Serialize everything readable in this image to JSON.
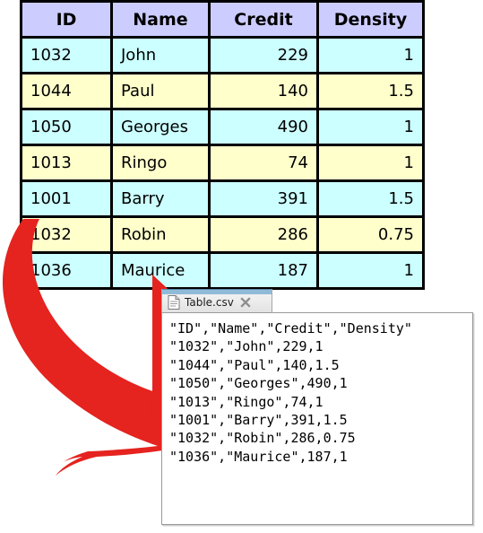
{
  "table": {
    "name": "spreadsheet-table",
    "columns": [
      "ID",
      "Name",
      "Credit",
      "Density"
    ],
    "rows": [
      {
        "id": "1032",
        "name": "John",
        "credit": "229",
        "density": "1"
      },
      {
        "id": "1044",
        "name": "Paul",
        "credit": "140",
        "density": "1.5"
      },
      {
        "id": "1050",
        "name": "Georges",
        "credit": "490",
        "density": "1"
      },
      {
        "id": "1013",
        "name": "Ringo",
        "credit": "74",
        "density": "1"
      },
      {
        "id": "1001",
        "name": "Barry",
        "credit": "391",
        "density": "1.5"
      },
      {
        "id": "1032",
        "name": "Robin",
        "credit": "286",
        "density": "0.75"
      },
      {
        "id": "1036",
        "name": "Maurice",
        "credit": "187",
        "density": "1"
      }
    ],
    "colors": {
      "header_background": "#ccccff",
      "row_odd_background": "#ccffff",
      "row_even_background": "#ffffcc",
      "border": "#000000"
    }
  },
  "arrow": {
    "name": "red-curved-arrow",
    "color": "#e5231f",
    "direction": "from-table-to-csv-file"
  },
  "csv_window": {
    "tab": {
      "label": "Table.csv",
      "document_icon": "document-icon",
      "close_icon": "close-icon"
    },
    "content": "\"ID\",\"Name\",\"Credit\",\"Density\"\n\"1032\",\"John\",229,1\n\"1044\",\"Paul\",140,1.5\n\"1050\",\"Georges\",490,1\n\"1013\",\"Ringo\",74,1\n\"1001\",\"Barry\",391,1.5\n\"1032\",\"Robin\",286,0.75\n\"1036\",\"Maurice\",187,1"
  }
}
